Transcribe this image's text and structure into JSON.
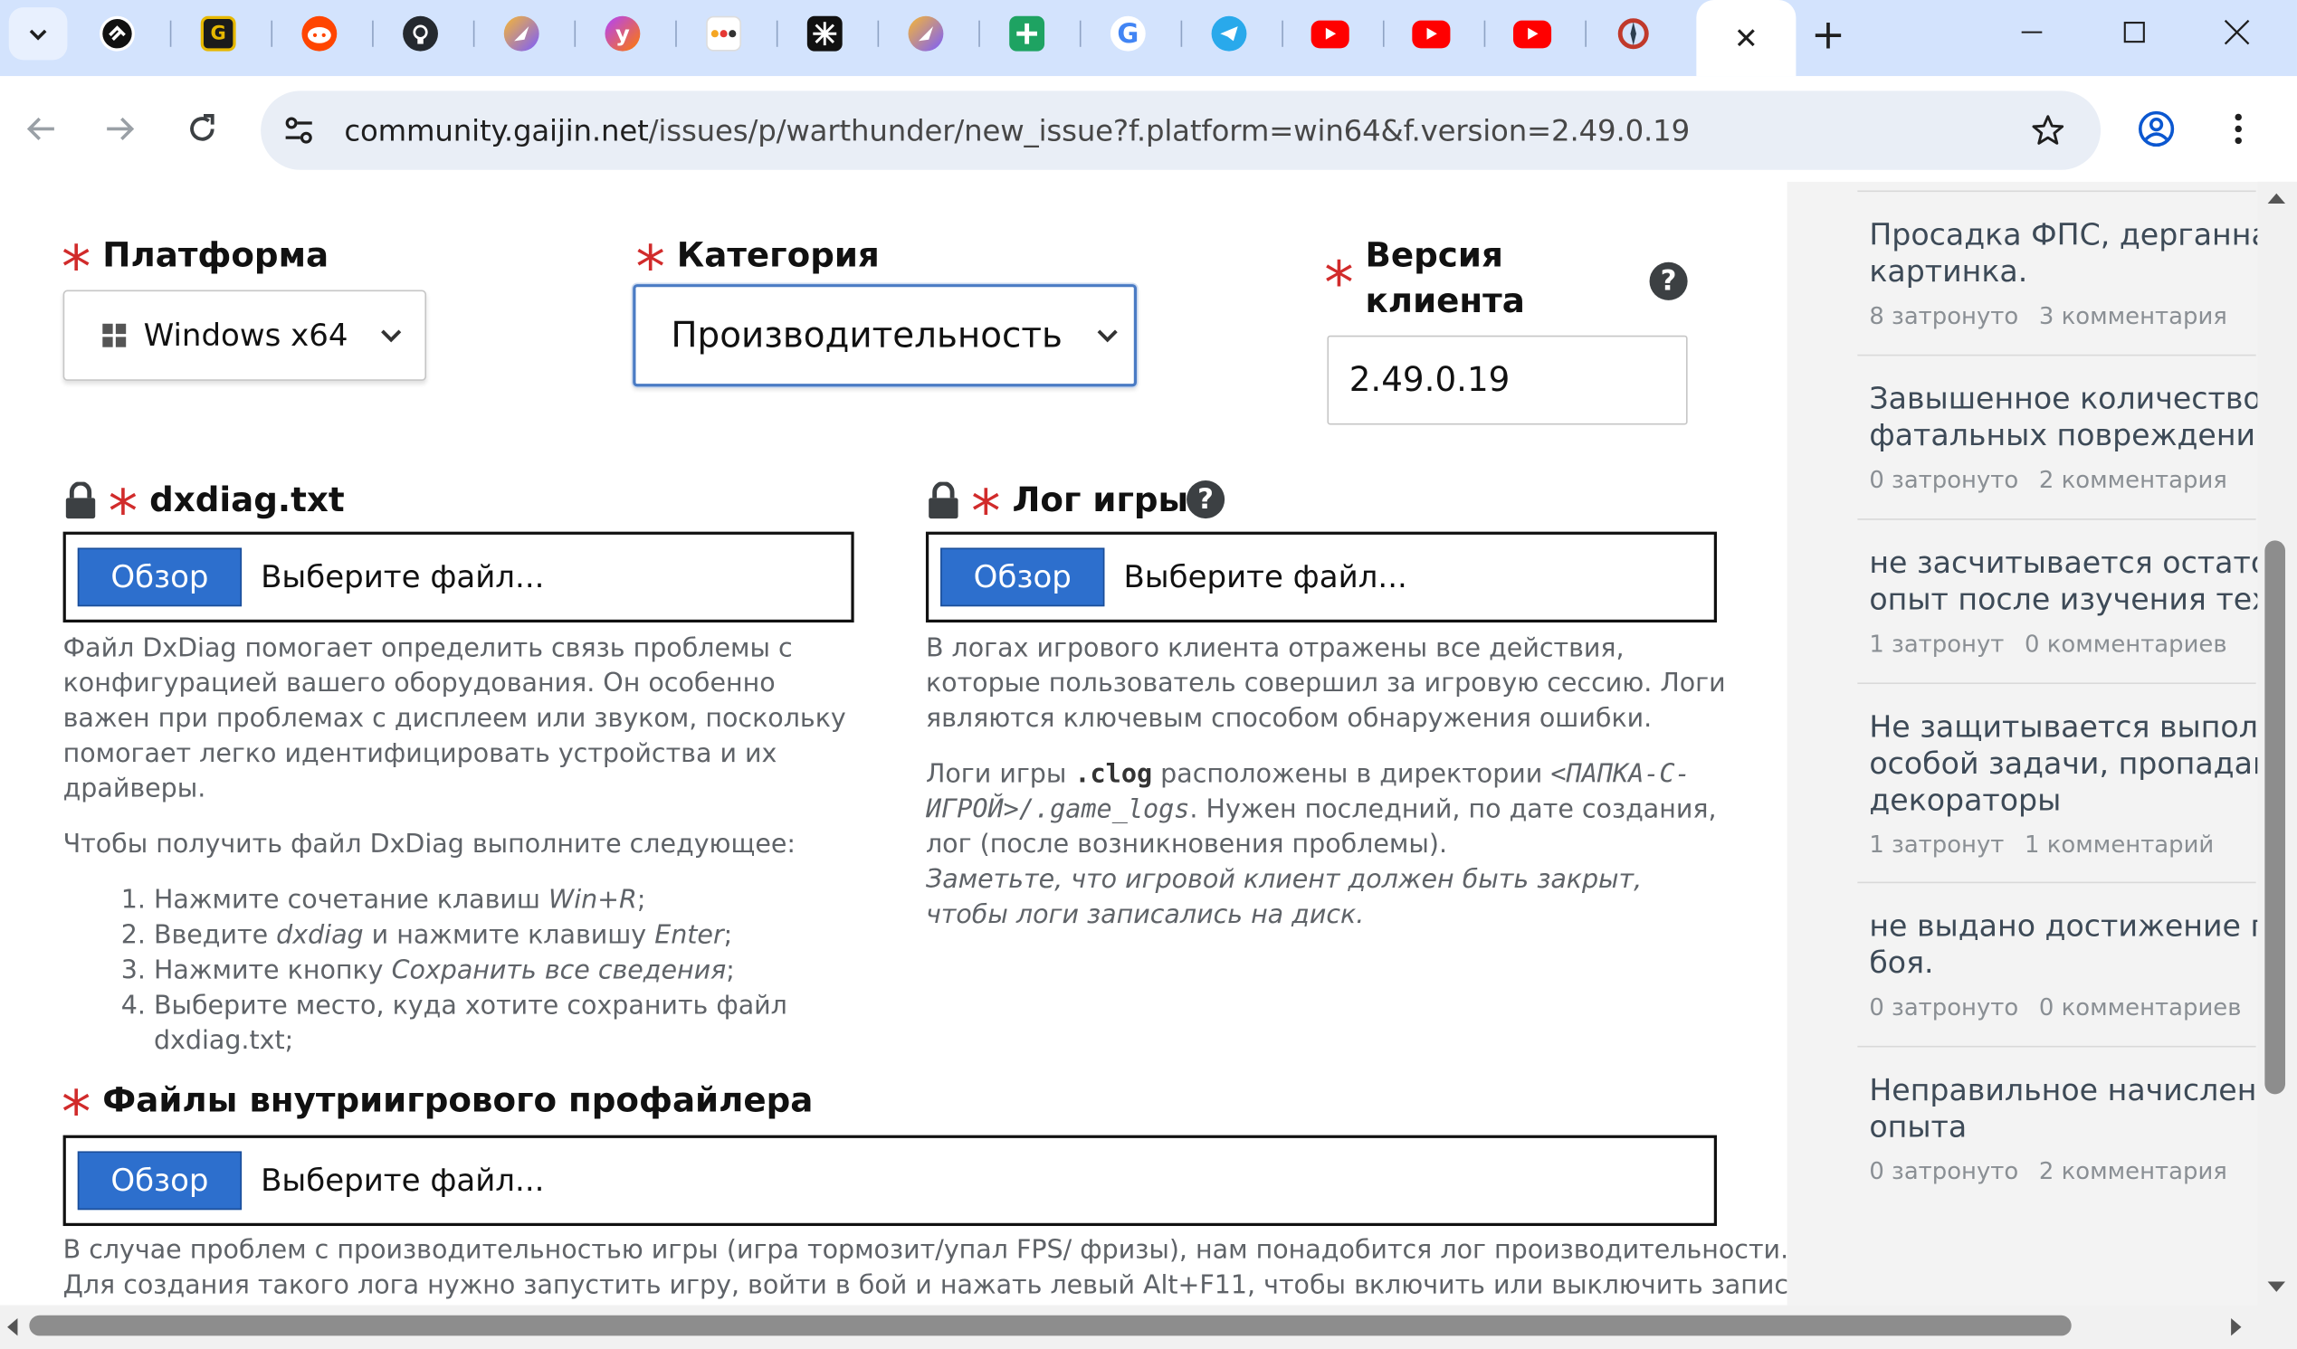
{
  "browser": {
    "tabs": [
      {
        "icon": "linktree-icon"
      },
      {
        "icon": "bookmark-app-icon"
      },
      {
        "icon": "reddit-icon"
      },
      {
        "icon": "github-icon"
      },
      {
        "icon": "rocket-icon"
      },
      {
        "icon": "yandex-icon"
      },
      {
        "icon": "dots-app-icon"
      },
      {
        "icon": "perplexity-icon"
      },
      {
        "icon": "rocket-icon"
      },
      {
        "icon": "green-cross-icon"
      },
      {
        "icon": "google-icon"
      },
      {
        "icon": "telegram-icon"
      },
      {
        "icon": "youtube-icon"
      },
      {
        "icon": "youtube-icon"
      },
      {
        "icon": "youtube-icon"
      },
      {
        "icon": "gaijin-icon"
      }
    ],
    "active_tab_close": "✕",
    "new_tab": "+",
    "url_host": "community.gaijin.net",
    "url_path": "/issues/p/warthunder/new_issue?f.platform=win64&f.version=2.49.0.19"
  },
  "form": {
    "platform": {
      "label": "Платформа",
      "value": "Windows x64"
    },
    "category": {
      "label": "Категория",
      "value": "Производительность"
    },
    "version": {
      "label_line1": "Версия",
      "label_line2": "клиента",
      "value": "2.49.0.19",
      "help": "?"
    },
    "dxdiag": {
      "label": "dxdiag.txt",
      "browse": "Обзор",
      "placeholder": "Выберите файл...",
      "desc_p1": "Файл DxDiag помогает определить связь проблемы с конфигурацией вашего оборудования. Он особенно важен при проблемах с дисплеем или звуком, поскольку помогает легко идентифицировать устройства и их драйверы.",
      "desc_p2": "Чтобы получить файл DxDiag выполните следующее:",
      "steps": [
        {
          "pre": "Нажмите сочетание клавиш ",
          "em": "Win+R",
          "post": ";"
        },
        {
          "pre": "Введите ",
          "em": "dxdiag",
          "mid": " и нажмите клавишу ",
          "em2": "Enter",
          "post": ";"
        },
        {
          "pre": "Нажмите кнопку ",
          "em": "Сохранить все сведения",
          "post": ";"
        },
        {
          "pre": "Выберите место, куда хотите сохранить файл dxdiag.txt;"
        }
      ]
    },
    "gamelog": {
      "label": "Лог игры",
      "help": "?",
      "browse": "Обзор",
      "placeholder": "Выберите файл...",
      "desc_p1": "В логах игрового клиента отражены все действия, которые пользователь совершил за игровую сессию. Логи являются ключевым способом обнаружения ошибки.",
      "desc_p2_a": "Логи игры ",
      "desc_p2_code": ".clog",
      "desc_p2_b": " расположены в директории ",
      "desc_p2_path": "<ПАПКА-С-ИГРОЙ>/.game_logs",
      "desc_p2_c": ". Нужен последний, по дате создания, лог (после возникновения проблемы).",
      "desc_p2_note": "Заметьте, что игровой клиент должен быть закрыт, чтобы логи записались на диск."
    },
    "profiler": {
      "label": "Файлы внутриигрового профайлера",
      "browse": "Обзор",
      "placeholder": "Выберите файл...",
      "desc_line1": "В случае проблем с производительностью игры (игра тормозит/упал FPS/ фризы), нам понадобится лог производительности.",
      "desc_line2": "Для создания такого лога нужно запустить игру, войти в бой и нажать левый Alt+F11, чтобы включить или выключить запись. При"
    }
  },
  "sidebar": {
    "items": [
      {
        "title1": "Просадка ФПС, дерганная",
        "title2": "картинка.",
        "affected": "8 затронуто",
        "comments": "3 комментария"
      },
      {
        "title1": "Завышенное количество",
        "title2": "фатальных повреждений (",
        "affected": "0 затронуто",
        "comments": "2 комментария"
      },
      {
        "title1": "не засчитывается остаточ",
        "title2": "опыт после изучения техн",
        "affected": "1 затронут",
        "comments": "0 комментариев"
      },
      {
        "title1": "Не защитывается выполн",
        "title2": "особой задачи, пропадаю",
        "title3": "декораторы",
        "affected": "1 затронут",
        "comments": "1 комментарий"
      },
      {
        "title1": "не выдано достижение по",
        "title2": "боя.",
        "affected": "0 затронуто",
        "comments": "0 комментариев"
      },
      {
        "title1": "Неправильное начислени",
        "title2": "опыта",
        "affected": "0 затронуто",
        "comments": "2 комментария"
      }
    ]
  },
  "colors": {
    "accent": "#2d6fcd",
    "required": "#d12b2b",
    "tabstrip": "#d3e3fd"
  }
}
